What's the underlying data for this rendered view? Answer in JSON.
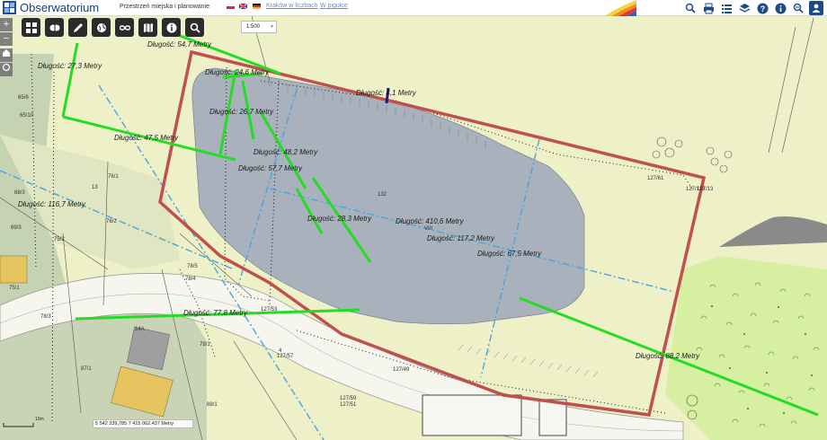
{
  "header": {
    "app_title": "Obserwatorium",
    "subtitle": "Przestrzeń miejska i planowanie",
    "links": [
      "Kraków w liczbach",
      "W pigułce"
    ],
    "flags": [
      "pl",
      "en",
      "de"
    ],
    "icons": [
      "bell-icon",
      "print-icon",
      "layers-list-icon",
      "layers-icon",
      "help-icon",
      "info-icon",
      "search-map-icon",
      "user-icon"
    ],
    "rainbow_colors": [
      "#f6d53c",
      "#f08a24",
      "#e2342c",
      "#2a62c8"
    ]
  },
  "toolbar": {
    "icons": [
      "grid-icon",
      "brain-icon",
      "edit-icon",
      "globe-icon",
      "link-icon",
      "map-icon",
      "info-icon",
      "search-icon"
    ],
    "scale_value": "1:500"
  },
  "zoom": {
    "plus": "+",
    "minus": "−"
  },
  "measurements": [
    "Długość: 54,7 Metry",
    "Długość: 27,3 Metry",
    "Długość: 24,6 Metry",
    "Długość: 26,7 Metry",
    "Długość: 47,5 Metry",
    "Długość: 48,2 Metry",
    "Długość: 57,7 Metry",
    "Długość: 116,7 Metry",
    "Długość: 28,3 Metry",
    "Długość: 410,6 Metry",
    "Długość: 117,2 Metry",
    "Długość: 67,5 Metry",
    "Długość: 77,8 Metry",
    "Długość: 88,2 Metry",
    "Długość: 4,1 Metry"
  ],
  "parcels": [
    "132",
    "127/113",
    "65/8",
    "65/10",
    "76/1",
    "13",
    "68/3",
    "69/3",
    "76/2",
    "75/2",
    "75/1",
    "78/5",
    "78/4",
    "78/3",
    "78/1",
    "127/53",
    "14A",
    "87/1",
    "88/1",
    "127/57",
    "127/49",
    "127/59",
    "127/51",
    "127/61",
    "VIII",
    "127/13",
    "4"
  ],
  "coordinates": "5 542 339,785 7 415 062,437 Metry",
  "scalebar_label": "10m",
  "colors": {
    "boundary": "#c0504d",
    "measure_line": "#22dd22",
    "polygon_fill": "#a9b2bc",
    "field": "#eef1c8",
    "grass": "#d7efa0",
    "dashed_blue": "#4aa3df"
  }
}
